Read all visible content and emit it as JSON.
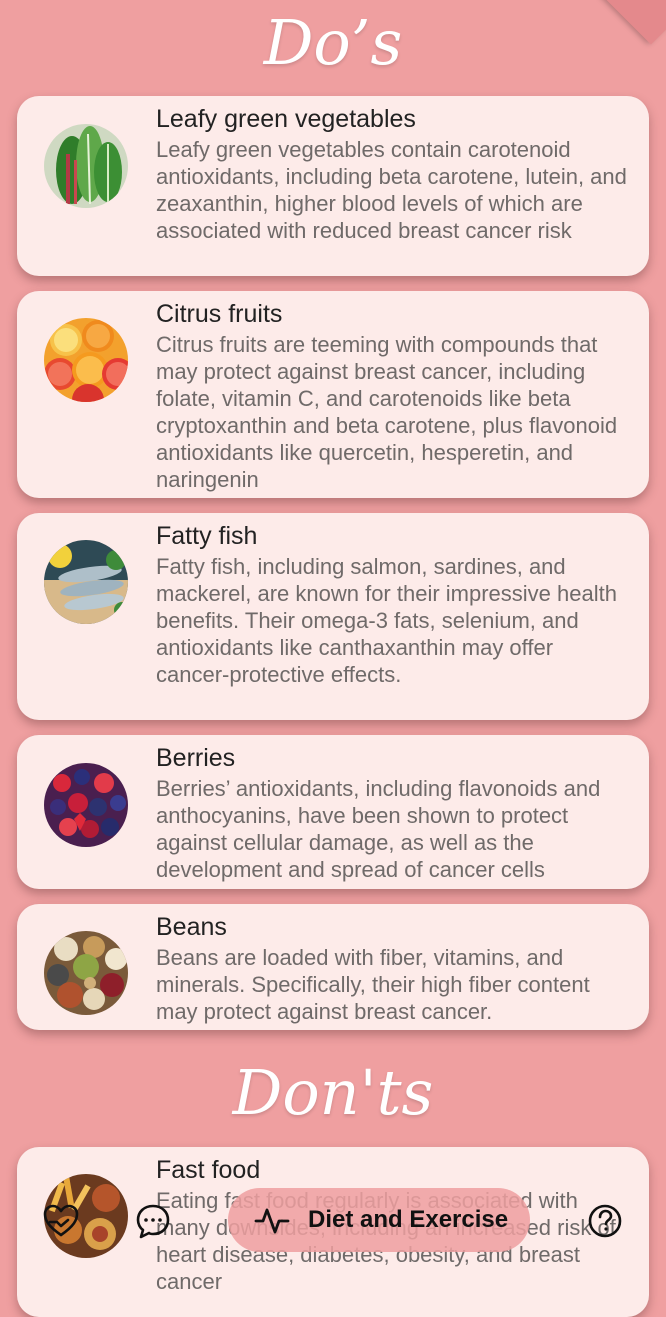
{
  "sections": {
    "dos_title": "Do’s",
    "donts_title": "Don'ts"
  },
  "dos": [
    {
      "title": "Leafy green vegetables",
      "description": "Leafy green vegetables contain carotenoid antioxidants, including beta carotene, lutein, and zeaxanthin, higher blood levels of which are associated with reduced breast cancer risk",
      "image": "leafy-greens-photo"
    },
    {
      "title": "Citrus fruits",
      "description": "Citrus fruits are teeming with compounds that may protect against breast cancer, including folate, vitamin C, and carotenoids like beta cryptoxanthin and beta carotene, plus flavonoid antioxidants like quercetin, hesperetin, and naringenin",
      "image": "citrus-fruits-photo"
    },
    {
      "title": "Fatty fish",
      "description": "Fatty fish, including salmon, sardines, and mackerel, are known for their impressive health benefits. Their omega-3 fats, selenium, and antioxidants like canthaxanthin may offer cancer-protective effects.",
      "image": "fatty-fish-photo"
    },
    {
      "title": "Berries",
      "description": "Berries’ antioxidants, including flavonoids and anthocyanins, have been shown to protect against cellular damage, as well as the development and spread of cancer cells",
      "image": "berries-photo"
    },
    {
      "title": "Beans",
      "description": "Beans are loaded with fiber, vitamins, and minerals. Specifically, their high fiber content may protect against breast cancer.",
      "image": "beans-photo"
    }
  ],
  "donts": [
    {
      "title": "Fast food",
      "description": "Eating fast food regularly is associated with many downsides, including an increased risk of heart disease, diabetes, obesity, and breast cancer",
      "image": "fast-food-photo"
    }
  ],
  "bottom_nav": {
    "items": [
      {
        "icon": "heart-hand-icon"
      },
      {
        "icon": "chat-bubble-icon"
      },
      {
        "icon": "activity-pulse-icon",
        "label": "Diet and Exercise",
        "active": true
      },
      {
        "icon": "help-circle-icon"
      }
    ]
  },
  "colors": {
    "background": "#ef9fa0",
    "card": "#fdebe9",
    "title_text": "#ffffff",
    "body_text": "#6f6a69"
  }
}
